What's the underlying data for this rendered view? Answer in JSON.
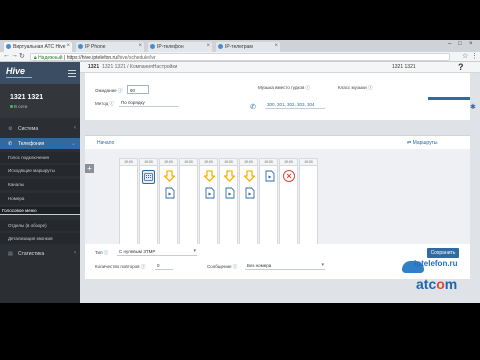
{
  "browser": {
    "tabs": [
      {
        "title": "Виртуальная АТС Hive",
        "active": true
      },
      {
        "title": "IP Phone",
        "active": false
      },
      {
        "title": "IP-телефон",
        "active": false
      },
      {
        "title": "IP-телеграм",
        "active": false
      }
    ],
    "url_secure_label": "Надежный",
    "url_host": "https://hive.iptelefon.ru",
    "url_path": "/hive/schedule/ivr"
  },
  "sidebar": {
    "logo": "Hive",
    "user_name": "1321 1321",
    "user_status": "В сети",
    "menu": [
      {
        "label": "Система",
        "icon": "gear-icon"
      },
      {
        "label": "Телефония",
        "icon": "phone-icon",
        "open": true
      }
    ],
    "submenu": [
      "Голос подключения",
      "Исходящие маршруты",
      "Каналы",
      "Номера",
      "Голосовое меню",
      "Отделы (в обзоре)",
      "Детализация звонков"
    ],
    "bottom_menu": [
      {
        "label": "Статистика",
        "icon": "chart-icon"
      }
    ]
  },
  "header": {
    "path_id": "1321",
    "path_name": "1321 1321 / КомпанияНастройки",
    "right_text": "1321 1321",
    "help": "?"
  },
  "settings": {
    "wait_label": "Ожидание",
    "wait_value": "60",
    "method_label": "Метод",
    "method_value": "По порядку",
    "group_label": "Музыка вместо гудков",
    "music_label": "Класс музыки",
    "extensions": "300, 301, 302, 303, 304"
  },
  "schedule": {
    "title": "Начало",
    "routes_label": "Маршруты",
    "add": "+",
    "columns": [
      "19:00",
      "19:00",
      "19:00",
      "19:00",
      "19:00",
      "19:00",
      "19:00",
      "19:00",
      "19:00",
      "19:00"
    ],
    "footer": {
      "type_label": "Тип",
      "type_value": "С нулевым ЗТМР",
      "repeat_label": "Количество повторов",
      "repeat_value": "0",
      "msg_label": "Сообщение",
      "msg_value": "Без номера",
      "save": "Сохранить"
    }
  },
  "watermark": {
    "site": "iptelefon.ru",
    "brand_a": "atc",
    "brand_o": "o",
    "brand_b": "m"
  },
  "colors": {
    "sidebar_bg": "#2b2e32",
    "accent": "#2f6ba3",
    "action_arrow": "#f5b400",
    "stop": "#e0463a"
  }
}
